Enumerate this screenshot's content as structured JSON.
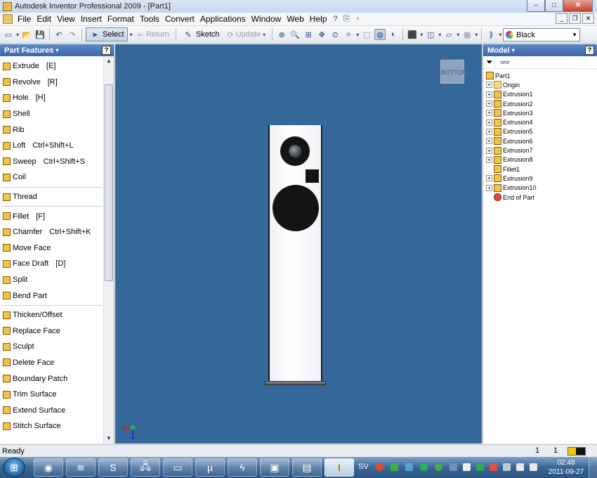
{
  "window": {
    "title": "Autodesk Inventor Professional 2009 - [Part1]",
    "controls": {
      "minimize": "–",
      "maximize": "□",
      "close": "✕"
    }
  },
  "menubar": {
    "items": [
      "File",
      "Edit",
      "View",
      "Insert",
      "Format",
      "Tools",
      "Convert",
      "Applications",
      "Window",
      "Web",
      "Help"
    ],
    "mdi_controls": [
      "_",
      "❐",
      "✕"
    ]
  },
  "toolbar": {
    "select_label": "Select",
    "return_label": "Return",
    "sketch_label": "Sketch",
    "update_label": "Update",
    "color_label": "Black"
  },
  "left_panel": {
    "title": "Part Features",
    "help": "?",
    "features": [
      {
        "label": "Extrude",
        "shortcut": "[E]"
      },
      {
        "label": "Revolve",
        "shortcut": "[R]"
      },
      {
        "label": "Hole",
        "shortcut": "[H]"
      },
      {
        "label": "Shell",
        "shortcut": ""
      },
      {
        "label": "Rib",
        "shortcut": ""
      },
      {
        "label": "Loft",
        "shortcut": "Ctrl+Shift+L"
      },
      {
        "label": "Sweep",
        "shortcut": "Ctrl+Shift+S"
      },
      {
        "label": "Coil",
        "shortcut": ""
      },
      {
        "divider": true
      },
      {
        "label": "Thread",
        "shortcut": ""
      },
      {
        "divider": true
      },
      {
        "label": "Fillet",
        "shortcut": "[F]"
      },
      {
        "label": "Chamfer",
        "shortcut": "Ctrl+Shift+K"
      },
      {
        "label": "Move Face",
        "shortcut": ""
      },
      {
        "label": "Face Draft",
        "shortcut": "[D]"
      },
      {
        "label": "Split",
        "shortcut": ""
      },
      {
        "label": "Bend Part",
        "shortcut": ""
      },
      {
        "divider": true
      },
      {
        "label": "Thicken/Offset",
        "shortcut": ""
      },
      {
        "label": "Replace Face",
        "shortcut": ""
      },
      {
        "label": "Sculpt",
        "shortcut": ""
      },
      {
        "label": "Delete Face",
        "shortcut": ""
      },
      {
        "label": "Boundary Patch",
        "shortcut": ""
      },
      {
        "label": "Trim Surface",
        "shortcut": ""
      },
      {
        "label": "Extend Surface",
        "shortcut": ""
      },
      {
        "label": "Stitch Surface",
        "shortcut": ""
      }
    ]
  },
  "viewport": {
    "viewcube_label": "BOTTOM"
  },
  "right_panel": {
    "title": "Model",
    "help": "?",
    "tree": [
      {
        "label": "Part1",
        "kind": "part",
        "expandable": false,
        "indent": 0
      },
      {
        "label": "Origin",
        "kind": "folder",
        "expandable": true,
        "indent": 1
      },
      {
        "label": "Extrusion1",
        "kind": "feature",
        "expandable": true,
        "indent": 1
      },
      {
        "label": "Extrusion2",
        "kind": "feature",
        "expandable": true,
        "indent": 1
      },
      {
        "label": "Extrusion3",
        "kind": "feature",
        "expandable": true,
        "indent": 1
      },
      {
        "label": "Extrusion4",
        "kind": "feature",
        "expandable": true,
        "indent": 1
      },
      {
        "label": "Extrusion5",
        "kind": "feature",
        "expandable": true,
        "indent": 1
      },
      {
        "label": "Extrusion6",
        "kind": "feature",
        "expandable": true,
        "indent": 1
      },
      {
        "label": "Extrusion7",
        "kind": "feature",
        "expandable": true,
        "indent": 1
      },
      {
        "label": "Extrusion8",
        "kind": "feature",
        "expandable": true,
        "indent": 1
      },
      {
        "label": "Fillet1",
        "kind": "feature",
        "expandable": false,
        "indent": 1
      },
      {
        "label": "Extrusion9",
        "kind": "feature",
        "expandable": true,
        "indent": 1
      },
      {
        "label": "Extrusion10",
        "kind": "feature",
        "expandable": true,
        "indent": 1
      },
      {
        "label": "End of Part",
        "kind": "end",
        "expandable": false,
        "indent": 1
      }
    ]
  },
  "statusbar": {
    "text": "Ready",
    "count_a": "1",
    "count_b": "1"
  },
  "taskbar": {
    "language": "SV",
    "time": "02:48",
    "date": "2011-09-27",
    "apps": [
      "chrome-icon",
      "spotify-icon",
      "skype-icon",
      "network-icon",
      "folder-icon",
      "utorrent-icon",
      "flash-icon",
      "monitor-icon",
      "notepad-icon",
      "inventor-icon"
    ]
  }
}
